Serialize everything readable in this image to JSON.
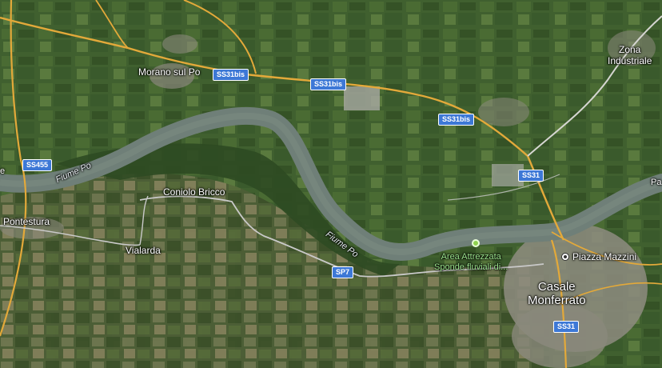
{
  "map": {
    "places": {
      "morano": "Morano sul Po",
      "zona": "Zona\nIndustriale",
      "pontestura": "Pontestura",
      "coniolo": "Coniolo Bricco",
      "vialarda": "Vialarda",
      "casale": "Casale\nMonferrato",
      "piazza": "Piazza Mazzini",
      "area": "Area Attrezzata\nSponde fluviali di...",
      "edge_left": "e",
      "edge_right": "Pa"
    },
    "river": {
      "label_1": "Fiume Po",
      "label_2": "Fiume Po"
    },
    "roads": {
      "ss31bis_a": "SS31bis",
      "ss31bis_b": "SS31bis",
      "ss31bis_c": "SS31bis",
      "ss455": "SS455",
      "ss31_a": "SS31",
      "ss31_b": "SS31",
      "sp7": "SP7"
    },
    "colors": {
      "river": "#6f7f78",
      "major_road": "#e3a93a",
      "minor_road": "#c9c9c9",
      "shield": "#3d78d6",
      "urban": "#8e8c80"
    }
  }
}
